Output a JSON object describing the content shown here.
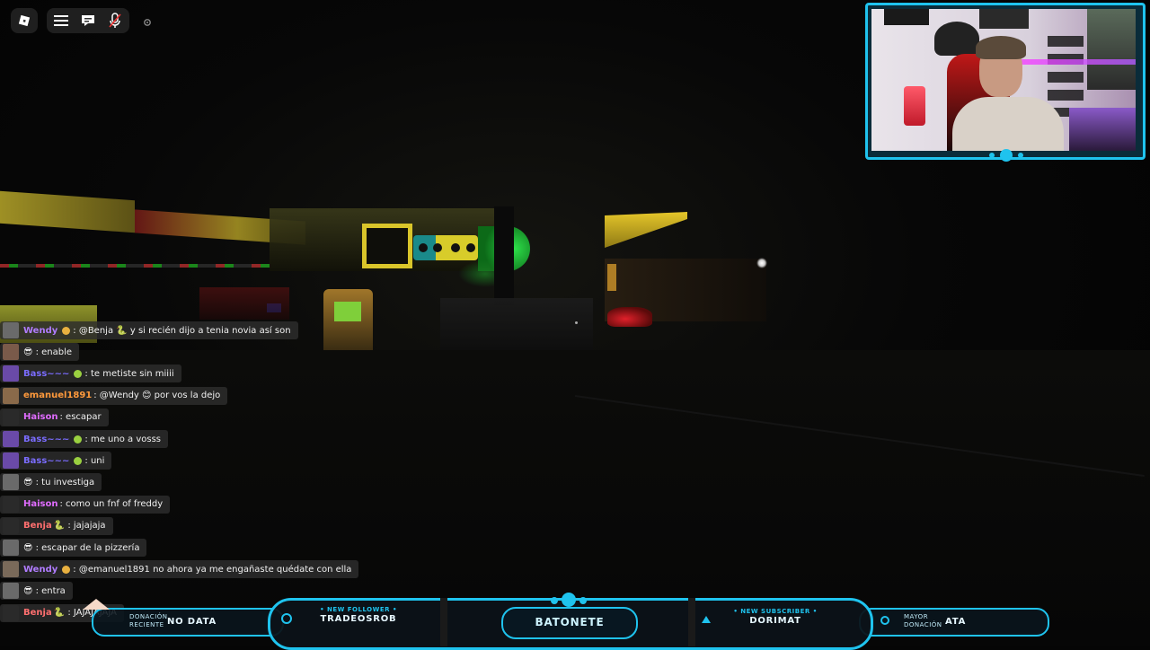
{
  "topbar": {
    "icons": [
      "roblox-logo-icon",
      "menu-icon",
      "chat-icon",
      "mic-muted-icon",
      "settings-icon"
    ]
  },
  "chat": {
    "messages": [
      {
        "user": "Wendy",
        "user_color": "#b07cff",
        "badge": "#e8b040",
        "text": ": @Benja 🐍 y si recién dijo a tenia novia así son"
      },
      {
        "user": "",
        "user_color": "#ffffff",
        "badge": "",
        "text": "😎 : enable"
      },
      {
        "user": "Bass~~~",
        "user_color": "#7a6cff",
        "badge": "#9ad040",
        "text": ": te metiste sin miiii"
      },
      {
        "user": "emanuel1891",
        "user_color": "#ff9a3c",
        "badge": "",
        "text": ": @Wendy 😊 por vos la dejo"
      },
      {
        "user": "Haison",
        "user_color": "#e06cff",
        "badge": "",
        "text": ": escapar"
      },
      {
        "user": "Bass~~~",
        "user_color": "#7a6cff",
        "badge": "#9ad040",
        "text": ": me uno a vosss"
      },
      {
        "user": "Bass~~~",
        "user_color": "#7a6cff",
        "badge": "#9ad040",
        "text": ": uni"
      },
      {
        "user": "",
        "user_color": "#ffffff",
        "badge": "",
        "text": "😎 : tu investiga"
      },
      {
        "user": "Haison",
        "user_color": "#e06cff",
        "badge": "",
        "text": ": como un fnf of freddy"
      },
      {
        "user": "Benja",
        "user_color": "#ff6f6f",
        "badge": "",
        "text": "🐍 : jajajaja"
      },
      {
        "user": "",
        "user_color": "#ffffff",
        "badge": "",
        "text": "😎 : escapar de la pizzería"
      },
      {
        "user": "Wendy",
        "user_color": "#b07cff",
        "badge": "#e8b040",
        "text": ": @emanuel1891 no ahora ya me engañaste quédate con ella"
      },
      {
        "user": "",
        "user_color": "#ffffff",
        "badge": "",
        "text": "😎 : entra"
      },
      {
        "user": "Benja",
        "user_color": "#ff6f6f",
        "badge": "",
        "text": "🐍 : JAJAJAJAJA"
      }
    ]
  },
  "stream_bar": {
    "donation_label": "DONACIÓN RECIENTE",
    "donation_value": "NO DATA",
    "follower_label": "• NEW FOLLOWER •",
    "follower_value": "TRADEOSROB",
    "channel_name": "BATONETE",
    "subscriber_label": "• NEW SUBSCRIBER •",
    "subscriber_value": "DORIMAT",
    "top_donation_label": "MAYOR DONACIÓN",
    "top_donation_value": "ATA",
    "accent": "#1fc3ee"
  }
}
